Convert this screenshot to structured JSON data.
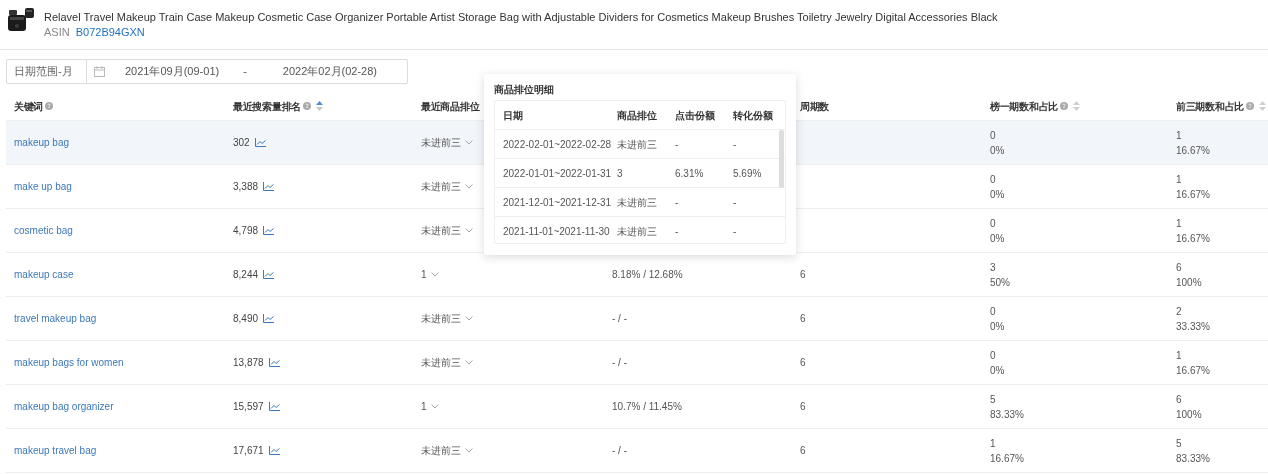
{
  "product": {
    "title": "Relavel Travel Makeup Train Case Makeup Cosmetic Case Organizer Portable Artist Storage Bag with Adjustable Dividers for Cosmetics Makeup Brushes Toiletry Jewelry Digital Accessories Black",
    "asin_label": "ASIN",
    "asin": "B072B94GXN"
  },
  "date_filter": {
    "mode": "日期范围-月",
    "start": "2021年09月(09-01)",
    "separator": "-",
    "end": "2022年02月(02-28)"
  },
  "table": {
    "columns": [
      {
        "label": "关键词",
        "help": true
      },
      {
        "label": "最近搜索量排名",
        "help": true,
        "sortable": true,
        "sorted_ascending": true
      },
      {
        "label": "最近商品排位"
      },
      {},
      {
        "label": "周期数"
      },
      {
        "label": "榜一期数和占比",
        "help": true,
        "sortable": true,
        "sorted_ascending": false
      },
      {
        "label": "前三期数和占比",
        "help": true,
        "sortable": true,
        "sorted_ascending": false
      }
    ],
    "rows": [
      {
        "selected": true,
        "keyword": "makeup bag",
        "search_rank": "302",
        "rank": "未进前三",
        "top1": "0",
        "top1_pct": "0%",
        "top3": "1",
        "top3_pct": "16.67%"
      },
      {
        "selected": false,
        "keyword": "make up bag",
        "search_rank": "3,388",
        "rank": "未进前三",
        "top1": "0",
        "top1_pct": "0%",
        "top3": "1",
        "top3_pct": "16.67%"
      },
      {
        "selected": false,
        "keyword": "cosmetic bag",
        "search_rank": "4,798",
        "rank": "未进前三",
        "top1": "0",
        "top1_pct": "0%",
        "top3": "1",
        "top3_pct": "16.67%"
      },
      {
        "selected": false,
        "keyword": "makeup case",
        "search_rank": "8,244",
        "rank": "1",
        "column_4": "8.18% / 12.68%",
        "periods": "6",
        "top1": "3",
        "top1_pct": "50%",
        "top3": "6",
        "top3_pct": "100%"
      },
      {
        "selected": false,
        "keyword": "travel makeup bag",
        "search_rank": "8,490",
        "rank": "未进前三",
        "column_4": "- / -",
        "periods": "6",
        "top1": "0",
        "top1_pct": "0%",
        "top3": "2",
        "top3_pct": "33.33%"
      },
      {
        "selected": false,
        "keyword": "makeup bags for women",
        "search_rank": "13,878",
        "rank": "未进前三",
        "column_4": "- / -",
        "periods": "6",
        "top1": "0",
        "top1_pct": "0%",
        "top3": "1",
        "top3_pct": "16.67%"
      },
      {
        "selected": false,
        "keyword": "makeup bag organizer",
        "search_rank": "15,597",
        "rank": "1",
        "column_4": "10.7% / 11.45%",
        "periods": "6",
        "top1": "5",
        "top1_pct": "83.33%",
        "top3": "6",
        "top3_pct": "100%"
      },
      {
        "selected": false,
        "keyword": "makeup travel bag",
        "search_rank": "17,671",
        "rank": "未进前三",
        "column_4": "- / -",
        "periods": "6",
        "top1": "1",
        "top1_pct": "16.67%",
        "top3": "5",
        "top3_pct": "83.33%"
      }
    ]
  },
  "popover": {
    "title": "商品排位明细",
    "columns": [
      "日期",
      "商品排位",
      "点击份额",
      "转化份额"
    ],
    "rows": [
      [
        "2022-02-01~2022-02-28",
        "未进前三",
        "-",
        "-"
      ],
      [
        "2022-01-01~2022-01-31",
        "3",
        "6.31%",
        "5.69%"
      ],
      [
        "2021-12-01~2021-12-31",
        "未进前三",
        "-",
        "-"
      ],
      [
        "2021-11-01~2021-11-30",
        "未进前三",
        "-",
        "-"
      ]
    ]
  }
}
